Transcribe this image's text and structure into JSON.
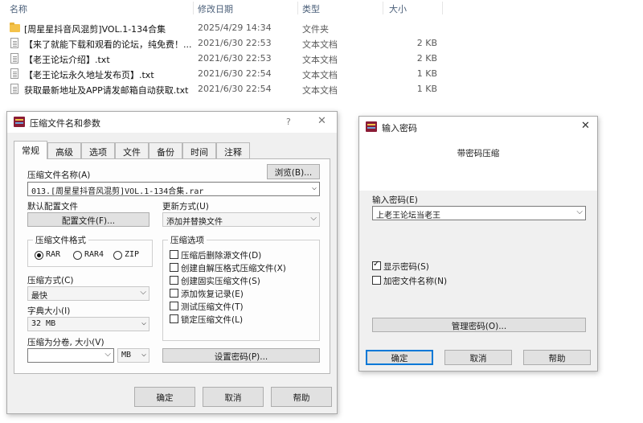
{
  "explorer": {
    "columns": {
      "name": "名称",
      "date": "修改日期",
      "type": "类型",
      "size": "大小"
    },
    "rows": [
      {
        "icon": "folder-icon",
        "name": "[周星星抖音风混剪]VOL.1-134合集",
        "date": "2025/4/29 14:34",
        "type": "文件夹",
        "size": ""
      },
      {
        "icon": "txt-file-icon",
        "name": "【来了就能下载和观看的论坛，纯免费！...",
        "date": "2021/6/30 22:53",
        "type": "文本文档",
        "size": "2 KB"
      },
      {
        "icon": "txt-file-icon",
        "name": "【老王论坛介绍】.txt",
        "date": "2021/6/30 22:53",
        "type": "文本文档",
        "size": "2 KB"
      },
      {
        "icon": "txt-file-icon",
        "name": "【老王论坛永久地址发布页】.txt",
        "date": "2021/6/30 22:54",
        "type": "文本文档",
        "size": "1 KB"
      },
      {
        "icon": "txt-file-icon",
        "name": "获取最新地址及APP请发邮箱自动获取.txt",
        "date": "2021/6/30 22:54",
        "type": "文本文档",
        "size": "1 KB"
      }
    ]
  },
  "archive_dialog": {
    "title": "压缩文件名和参数",
    "help": "?",
    "close": "✕",
    "tabs": [
      "常规",
      "高级",
      "选项",
      "文件",
      "备份",
      "时间",
      "注释"
    ],
    "archive_name_label": "压缩文件名称(A)",
    "browse_button": "浏览(B)...",
    "archive_name_value": "013.[周星星抖音风混剪]VOL.1-134合集.rar",
    "default_profile_label": "默认配置文件",
    "profile_button": "配置文件(F)...",
    "update_mode_label": "更新方式(U)",
    "update_mode_value": "添加并替换文件",
    "format_group": "压缩文件格式",
    "format_options": [
      "RAR",
      "RAR4",
      "ZIP"
    ],
    "format_selected": "RAR",
    "compression_method_label": "压缩方式(C)",
    "compression_method_value": "最快",
    "dictionary_label": "字典大小(I)",
    "dictionary_value": "32 MB",
    "split_label": "压缩为分卷, 大小(V)",
    "split_value": "",
    "split_unit": "MB",
    "options_group": "压缩选项",
    "options": [
      {
        "label": "压缩后删除源文件(D)",
        "checked": false
      },
      {
        "label": "创建自解压格式压缩文件(X)",
        "checked": false
      },
      {
        "label": "创建固实压缩文件(S)",
        "checked": false
      },
      {
        "label": "添加恢复记录(E)",
        "checked": false
      },
      {
        "label": "测试压缩文件(T)",
        "checked": false
      },
      {
        "label": "锁定压缩文件(L)",
        "checked": false
      }
    ],
    "set_password_button": "设置密码(P)...",
    "ok_button": "确定",
    "cancel_button": "取消",
    "help_button": "帮助"
  },
  "password_dialog": {
    "title": "输入密码",
    "close": "✕",
    "heading": "带密码压缩",
    "password_label": "输入密码(E)",
    "password_value": "上老王论坛当老王",
    "show_password_label": "显示密码(S)",
    "show_password_checked": true,
    "encrypt_names_label": "加密文件名称(N)",
    "encrypt_names_checked": false,
    "manage_button": "管理密码(O)...",
    "ok_button": "确定",
    "cancel_button": "取消",
    "help_button": "帮助"
  }
}
